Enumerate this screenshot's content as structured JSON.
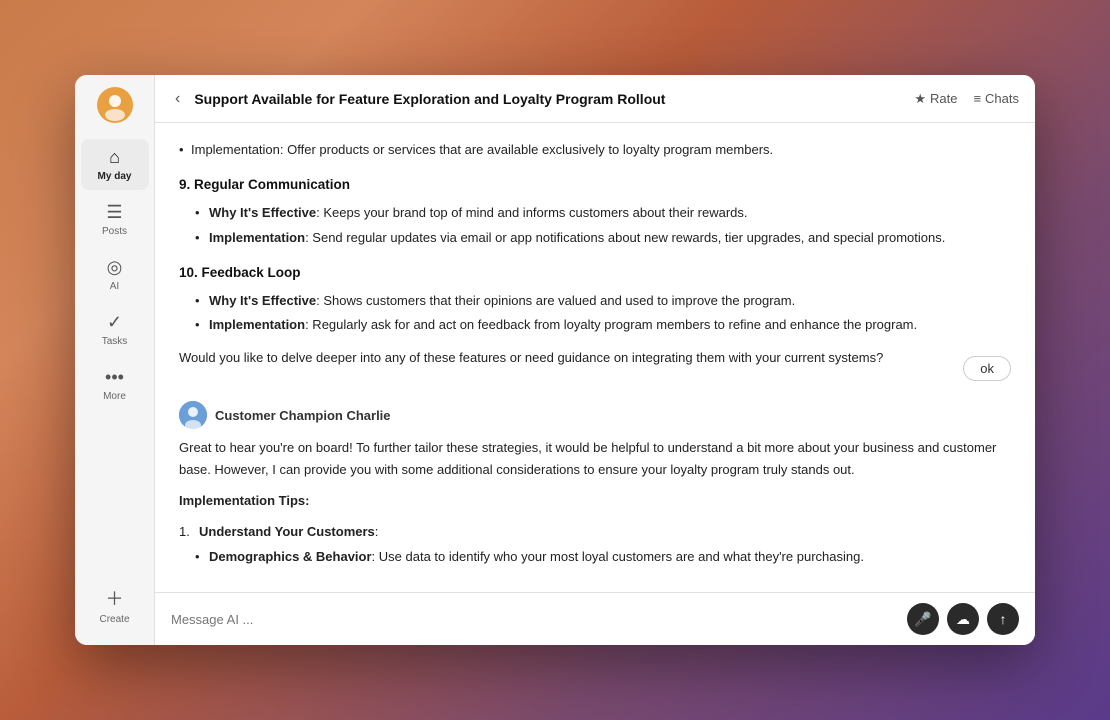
{
  "window": {
    "title": "Support Available for Feature Exploration and Loyalty Program Rollout"
  },
  "header": {
    "title": "Support Available for Feature Exploration and Loyalty Program Rollout",
    "back_label": "‹",
    "rate_label": "Rate",
    "chats_label": "Chats"
  },
  "sidebar": {
    "logo_alt": "App Logo",
    "items": [
      {
        "id": "my-day",
        "label": "My day",
        "icon": "⌂",
        "active": true
      },
      {
        "id": "posts",
        "label": "Posts",
        "icon": "≡",
        "active": false
      },
      {
        "id": "ai",
        "label": "AI",
        "icon": "◎",
        "active": false
      },
      {
        "id": "tasks",
        "label": "Tasks",
        "icon": "✓",
        "active": false
      },
      {
        "id": "more",
        "label": "More",
        "icon": "···",
        "active": false
      }
    ],
    "create_label": "Create",
    "create_icon": "+"
  },
  "chat": {
    "initial_bullets": [
      "Implementation: Offer products or services that are available exclusively to loyalty program members."
    ],
    "sections": [
      {
        "number": "9.",
        "title": "Regular Communication",
        "bullets": [
          {
            "label": "Why It's Effective",
            "text": ": Keeps your brand top of mind and informs customers about their rewards."
          },
          {
            "label": "Implementation",
            "text": ": Send regular updates via email or app notifications about new rewards, tier upgrades, and special promotions."
          }
        ]
      },
      {
        "number": "10.",
        "title": "Feedback Loop",
        "bullets": [
          {
            "label": "Why It's Effective",
            "text": ": Shows customers that their opinions are valued and used to improve the program."
          },
          {
            "label": "Implementation",
            "text": ": Regularly ask for and act on feedback from loyalty program members to refine and enhance the program."
          }
        ]
      }
    ],
    "closing_question": "Would you like to delve deeper into any of these features or need guidance on integrating them with your current systems?",
    "ok_button": "ok",
    "agent_name": "Customer Champion Charlie",
    "agent_intro": "Great to hear you're on board! To further tailor these strategies, it would be helpful to understand a bit more about your business and customer base. However, I can provide you with some additional considerations to ensure your loyalty program truly stands out.",
    "impl_tips_header": "Implementation Tips:",
    "impl_tips": [
      {
        "number": "1.",
        "title": "Understand Your Customers",
        "subbullets": [
          {
            "label": "Demographics & Behavior",
            "text": ": Use data to identify who your most loyal customers are and what they're purchasing."
          }
        ]
      }
    ]
  },
  "input": {
    "placeholder": "Message AI ...",
    "mic_icon": "🎤",
    "cloud_icon": "☁",
    "send_icon": "↑"
  }
}
